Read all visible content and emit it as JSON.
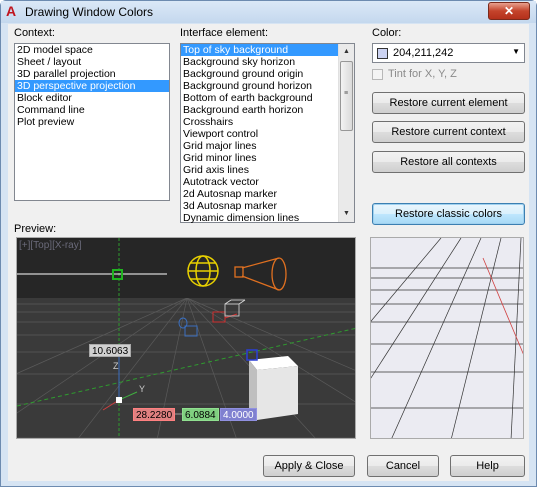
{
  "window": {
    "title": "Drawing Window Colors",
    "close_label": "✕"
  },
  "context": {
    "label": "Context:",
    "items": [
      "2D model space",
      "Sheet / layout",
      "3D parallel projection",
      "3D perspective projection",
      "Block editor",
      "Command line",
      "Plot preview"
    ],
    "selected_index": 3
  },
  "interface": {
    "label": "Interface element:",
    "items": [
      "Top of sky background",
      "Background sky horizon",
      "Background ground origin",
      "Background ground horizon",
      "Bottom of earth background",
      "Background earth horizon",
      "Crosshairs",
      "Viewport control",
      "Grid major lines",
      "Grid minor lines",
      "Grid axis lines",
      "Autotrack vector",
      "2d Autosnap marker",
      "3d Autosnap marker",
      "Dynamic dimension lines"
    ],
    "selected_index": 0
  },
  "color": {
    "label": "Color:",
    "value": "204,211,242",
    "swatch_hex": "#ccd3f2",
    "tint_label": "Tint for X, Y, Z",
    "tint_checked": false
  },
  "buttons": {
    "restore_current_element": "Restore current element",
    "restore_current_context": "Restore current context",
    "restore_all_contexts": "Restore all contexts",
    "restore_classic_colors": "Restore classic colors",
    "apply_close": "Apply & Close",
    "cancel": "Cancel",
    "help": "Help"
  },
  "preview": {
    "label": "Preview:",
    "viewport_label": "[+][Top][X-ray]",
    "dim_length": "10.6063",
    "coord_x": "28.2280",
    "coord_y": "6.0884",
    "coord_z": "4.0000",
    "axis_z": "Z",
    "axis_y": "Y"
  }
}
